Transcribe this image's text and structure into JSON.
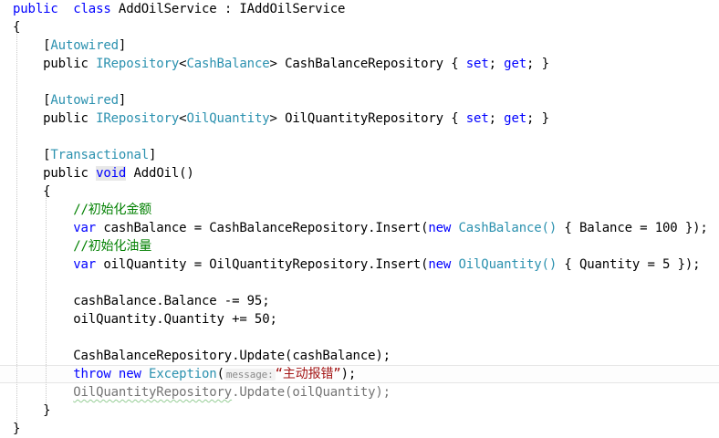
{
  "colors": {
    "keyword": "#0000ff",
    "type": "#2b91af",
    "comment": "#008000",
    "string": "#a31515",
    "text": "#000000",
    "hint": "#8a8a8a"
  },
  "editor": {
    "lines": [
      [
        [
          "kw",
          "public"
        ],
        [
          "",
          "  "
        ],
        [
          "kw",
          "class"
        ],
        [
          "",
          " AddOilService : IAddOilService"
        ]
      ],
      [
        [
          "",
          "{"
        ]
      ],
      [
        [
          "",
          "    ["
        ],
        [
          "type",
          "Autowired"
        ],
        [
          "",
          "]"
        ]
      ],
      [
        [
          "",
          "    public "
        ],
        [
          "type",
          "IRepository"
        ],
        [
          "",
          "<"
        ],
        [
          "type",
          "CashBalance"
        ],
        [
          "",
          "> CashBalanceRepository { "
        ],
        [
          "kw",
          "set"
        ],
        [
          "",
          "; "
        ],
        [
          "kw",
          "get"
        ],
        [
          "",
          "; }"
        ]
      ],
      [],
      [
        [
          "",
          "    ["
        ],
        [
          "type",
          "Autowired"
        ],
        [
          "",
          "]"
        ]
      ],
      [
        [
          "",
          "    public "
        ],
        [
          "type",
          "IRepository"
        ],
        [
          "",
          "<"
        ],
        [
          "type",
          "OilQuantity"
        ],
        [
          "",
          "> OilQuantityRepository { "
        ],
        [
          "kw",
          "set"
        ],
        [
          "",
          "; "
        ],
        [
          "kw",
          "get"
        ],
        [
          "",
          "; }"
        ]
      ],
      [],
      [
        [
          "",
          "    ["
        ],
        [
          "type",
          "Transactional"
        ],
        [
          "",
          "]"
        ]
      ],
      [
        [
          "",
          "    public "
        ],
        [
          "kw highlight-box",
          "void"
        ],
        [
          "",
          " AddOil()"
        ]
      ],
      [
        [
          "",
          "    {"
        ]
      ],
      [
        [
          "",
          "        "
        ],
        [
          "cm",
          "//初始化金额"
        ]
      ],
      [
        [
          "",
          "        "
        ],
        [
          "kw",
          "var"
        ],
        [
          "",
          " cashBalance = CashBalanceRepository.Insert("
        ],
        [
          "kw",
          "new"
        ],
        [
          "",
          " "
        ],
        [
          "type",
          "CashBalance"
        ],
        [
          "type",
          "()"
        ],
        [
          "",
          " { Balance = 100 });"
        ]
      ],
      [
        [
          "",
          "        "
        ],
        [
          "cm",
          "//初始化油量"
        ]
      ],
      [
        [
          "",
          "        "
        ],
        [
          "kw",
          "var"
        ],
        [
          "",
          " oilQuantity = OilQuantityRepository.Insert("
        ],
        [
          "kw",
          "new"
        ],
        [
          "",
          " "
        ],
        [
          "type",
          "OilQuantity"
        ],
        [
          "type",
          "()"
        ],
        [
          "",
          " { Quantity = 5 });"
        ]
      ],
      [],
      [
        [
          "",
          "        cashBalance.Balance -= 95;"
        ]
      ],
      [
        [
          "",
          "        oilQuantity.Quantity += 50;"
        ]
      ],
      [],
      [
        [
          "",
          "        CashBalanceRepository.Update(cashBalance);"
        ]
      ],
      [
        [
          "",
          "        "
        ],
        [
          "kw",
          "throw"
        ],
        [
          "",
          " "
        ],
        [
          "kw",
          "new"
        ],
        [
          "",
          " "
        ],
        [
          "type",
          "Exception"
        ],
        [
          "",
          "("
        ],
        [
          "hint",
          "message:"
        ],
        [
          "str",
          "“主动报错”"
        ],
        [
          "",
          ");"
        ]
      ],
      [
        [
          "",
          "        "
        ],
        [
          "fade squiggle",
          "OilQuantityRepository"
        ],
        [
          "fade",
          ".Update(oilQuantity);"
        ]
      ],
      [
        [
          "",
          "    }"
        ]
      ],
      [
        [
          "",
          "}"
        ]
      ]
    ]
  }
}
